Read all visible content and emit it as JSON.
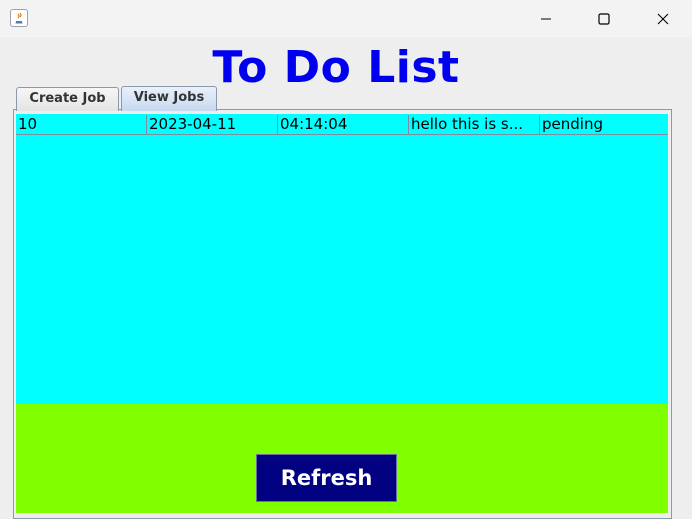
{
  "window": {
    "icon": "java-icon",
    "controls": [
      "minimize-icon",
      "maximize-icon",
      "close-icon"
    ]
  },
  "app": {
    "title": "To Do List"
  },
  "tabs": [
    {
      "label": "Create Job",
      "selected": false
    },
    {
      "label": "View Jobs",
      "selected": true
    }
  ],
  "jobs_table": {
    "rows": [
      [
        "10",
        "2023-04-11",
        "04:14:04",
        "hello this is s...",
        "pending"
      ]
    ]
  },
  "actions": {
    "refresh_label": "Refresh"
  },
  "colors": {
    "title": "#0000ee",
    "table_background": "#00ffff",
    "footer_background": "#80ff00",
    "button_background": "#000080",
    "button_text": "#ffffff"
  }
}
